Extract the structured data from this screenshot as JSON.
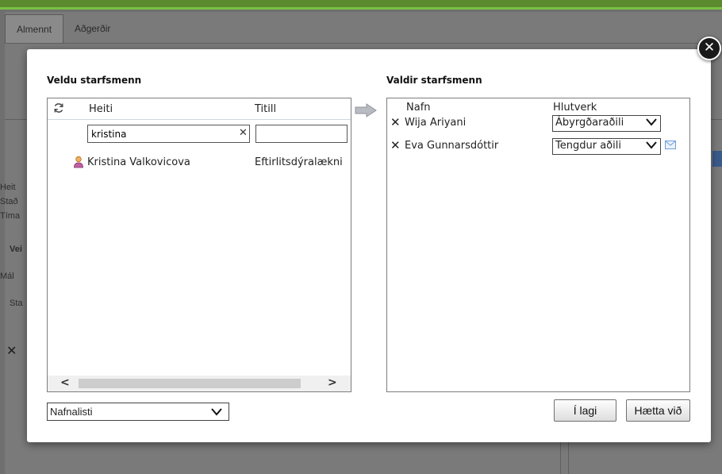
{
  "background": {
    "tabs": [
      "Almennt",
      "Aðgerðir"
    ],
    "side_labels": [
      "Heit",
      "Stað",
      "Tíma",
      "Vei",
      "Mál",
      "Sta"
    ]
  },
  "modal": {
    "left": {
      "title": "Veldu starfsmenn",
      "col_name": "Heiti",
      "col_title": "Titill",
      "filter_value": "kristina",
      "results": [
        {
          "name": "Kristina Valkovicova",
          "title": "Eftirlitsdýralækni"
        }
      ]
    },
    "right": {
      "title": "Valdir starfsmenn",
      "col_name": "Nafn",
      "col_role": "Hlutverk",
      "selected": [
        {
          "name": "Wija Ariyani",
          "role": "Ábyrgðaraðili",
          "mail": false
        },
        {
          "name": "Eva Gunnarsdóttir",
          "role": "Tengdur aðili",
          "mail": true
        }
      ]
    },
    "source_select": "Nafnalisti",
    "ok_label": "Í lagi",
    "cancel_label": "Hætta við"
  },
  "colors": {
    "accent_green": "#79c142",
    "mail_blue": "#6f9fd8"
  }
}
